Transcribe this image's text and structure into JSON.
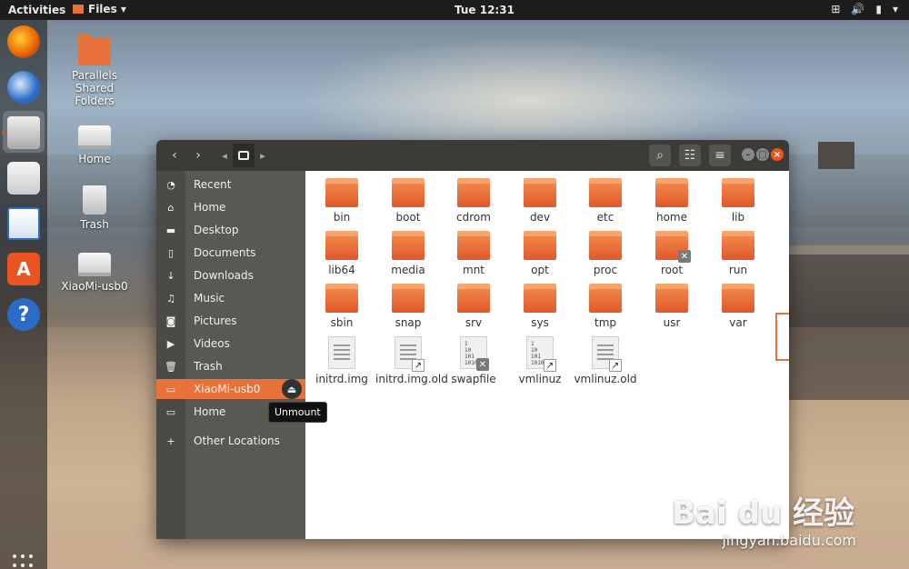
{
  "topbar": {
    "activities": "Activities",
    "app_menu": "Files ▾",
    "clock": "Tue 12:31",
    "status_icons": [
      "network-icon",
      "volume-icon",
      "battery-icon",
      "menu-arrow"
    ]
  },
  "dock": {
    "items": [
      "firefox",
      "thunderbird",
      "files",
      "rhythmbox",
      "libreoffice-writer",
      "software-center",
      "help"
    ]
  },
  "desktop": {
    "icons": [
      {
        "label": "Parallels Shared Folders"
      },
      {
        "label": "Home"
      },
      {
        "label": "Trash"
      },
      {
        "label": "XiaoMi-usb0"
      }
    ]
  },
  "sidebar": {
    "items": [
      {
        "label": "Recent",
        "icon": "clock-icon"
      },
      {
        "label": "Home",
        "icon": "home-icon"
      },
      {
        "label": "Desktop",
        "icon": "desktop-icon"
      },
      {
        "label": "Documents",
        "icon": "documents-icon"
      },
      {
        "label": "Downloads",
        "icon": "downloads-icon"
      },
      {
        "label": "Music",
        "icon": "music-icon"
      },
      {
        "label": "Pictures",
        "icon": "pictures-icon"
      },
      {
        "label": "Videos",
        "icon": "videos-icon"
      },
      {
        "label": "Trash",
        "icon": "trash-icon"
      },
      {
        "label": "XiaoMi-usb0",
        "icon": "drive-icon",
        "active": true
      },
      {
        "label": "Home",
        "icon": "drive-icon"
      },
      {
        "label": "Other Locations",
        "icon": "plus-icon"
      }
    ],
    "tooltip": "Unmount"
  },
  "files": [
    {
      "name": "bin",
      "type": "folder"
    },
    {
      "name": "boot",
      "type": "folder"
    },
    {
      "name": "cdrom",
      "type": "folder"
    },
    {
      "name": "dev",
      "type": "folder"
    },
    {
      "name": "etc",
      "type": "folder"
    },
    {
      "name": "home",
      "type": "folder"
    },
    {
      "name": "lib",
      "type": "folder"
    },
    {
      "name": "lib64",
      "type": "folder"
    },
    {
      "name": "media",
      "type": "folder"
    },
    {
      "name": "mnt",
      "type": "folder"
    },
    {
      "name": "opt",
      "type": "folder"
    },
    {
      "name": "proc",
      "type": "folder"
    },
    {
      "name": "root",
      "type": "folder",
      "locked": true
    },
    {
      "name": "run",
      "type": "folder"
    },
    {
      "name": "sbin",
      "type": "folder"
    },
    {
      "name": "snap",
      "type": "folder"
    },
    {
      "name": "srv",
      "type": "folder"
    },
    {
      "name": "sys",
      "type": "folder"
    },
    {
      "name": "tmp",
      "type": "folder"
    },
    {
      "name": "usr",
      "type": "folder",
      "selected": true
    },
    {
      "name": "var",
      "type": "folder"
    },
    {
      "name": "initrd.img",
      "type": "doc"
    },
    {
      "name": "initrd.img.old",
      "type": "doc-link"
    },
    {
      "name": "swapfile",
      "type": "binary-locked"
    },
    {
      "name": "vmlinuz",
      "type": "binary-link"
    },
    {
      "name": "vmlinuz.old",
      "type": "doc-link"
    }
  ],
  "watermark": {
    "main": "Bai du 经验",
    "sub": "jingyan.baidu.com"
  },
  "colors": {
    "accent": "#e9723b",
    "headerbar": "#3c3b37",
    "sidebar": "#5a5852"
  }
}
